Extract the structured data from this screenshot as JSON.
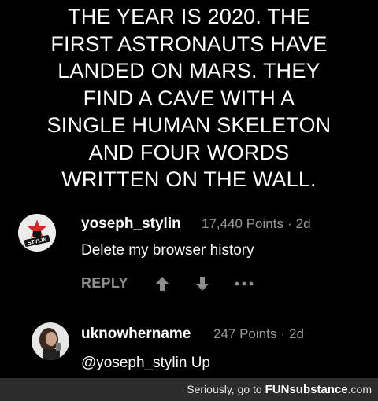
{
  "headline": {
    "lines": [
      "THE YEAR IS 2020. THE",
      "FIRST ASTRONAUTS HAVE",
      "LANDED ON MARS. THEY",
      "FIND A CAVE WITH A",
      "SINGLE HUMAN SKELETON",
      "AND FOUR WORDS",
      "WRITTEN ON THE WALL."
    ]
  },
  "comments": [
    {
      "username": "yoseph_stylin",
      "points": "17,440 Points",
      "separator": "·",
      "age": "2d",
      "text": "Delete my browser history",
      "avatar_text": "STYLIN"
    },
    {
      "username": "uknowhername",
      "points": "247 Points",
      "separator": "·",
      "age": "2d",
      "text": "@yoseph_stylin Up"
    }
  ],
  "actions": {
    "reply_label": "REPLY",
    "upvote_icon": "arrow-up-icon",
    "downvote_icon": "arrow-down-icon",
    "more_icon": "more-dots-icon"
  },
  "footer": {
    "prefix": "Seriously, go to ",
    "logo_funsub": "FUNsubstance",
    "logo_tld": ".com"
  },
  "colors": {
    "background": "#000000",
    "text": "#ffffff",
    "muted": "#9a9a9a",
    "footer_bg": "#2c2c2c",
    "avatar_star": "#d62828"
  }
}
